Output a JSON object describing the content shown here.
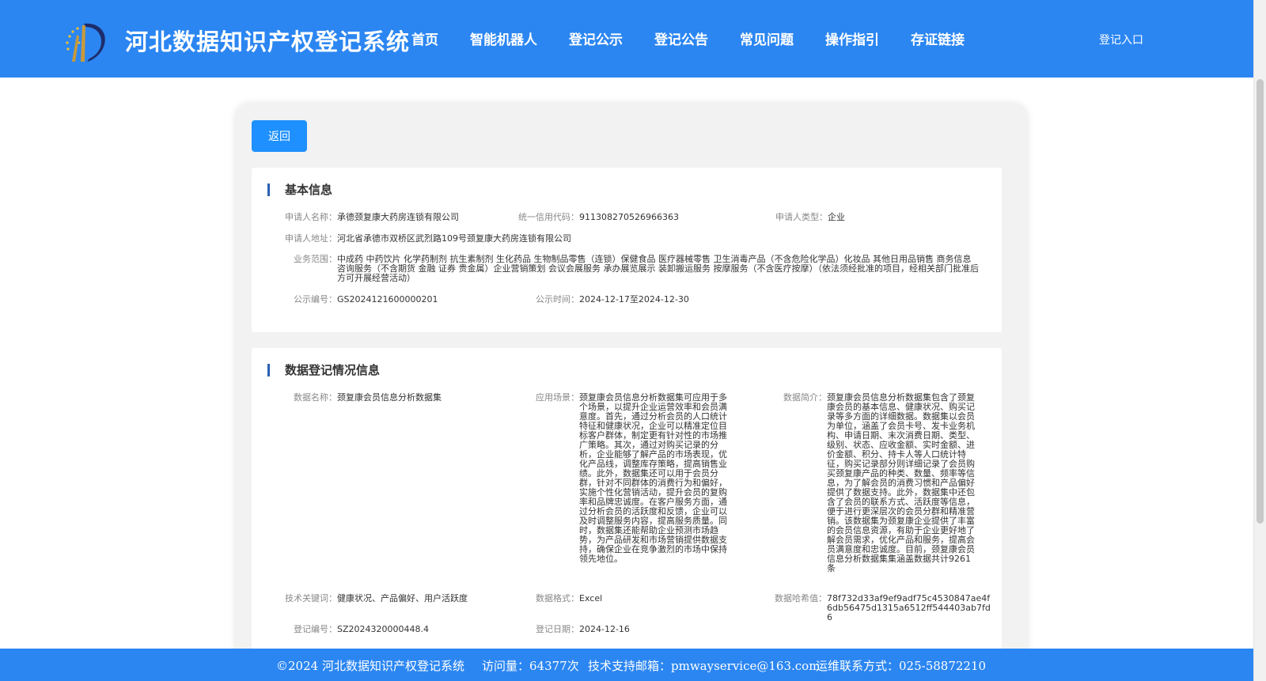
{
  "header": {
    "site_title": "河北数据知识产权登记系统",
    "nav": [
      "首页",
      "智能机器人",
      "登记公示",
      "登记公告",
      "常见问题",
      "操作指引",
      "存证链接"
    ],
    "login": "登记入口"
  },
  "back_button": "返回",
  "basic_info": {
    "title": "基本信息",
    "applicant_name": {
      "label": "申请人名称：",
      "value": "承德颈复康大药房连锁有限公司"
    },
    "credit_code": {
      "label": "统一信用代码：",
      "value": "911308270526966363"
    },
    "applicant_type": {
      "label": "申请人类型：",
      "value": "企业"
    },
    "address": {
      "label": "申请人地址：",
      "value": "河北省承德市双桥区武烈路109号颈复康大药房连锁有限公司"
    },
    "business_scope": {
      "label": "业务范围：",
      "value": "中成药 中药饮片 化学药制剂 抗生素制剂 生化药品 生物制品零售（连锁）保健食品 医疗器械零售 卫生消毒产品（不含危险化学品）化妆品 其他日用品销售 商务信息咨询服务（不含期货 金融 证券 贵金属）企业营销策划 会议会展服务 承办展览展示 装卸搬运服务 按摩服务（不含医疗按摩）（依法须经批准的项目，经相关部门批准后方可开展经营活动）"
    },
    "notice_no": {
      "label": "公示编号：",
      "value": "GS2024121600000201"
    },
    "notice_time": {
      "label": "公示时间：",
      "value": "2024-12-17至2024-12-30"
    }
  },
  "data_info": {
    "title": "数据登记情况信息",
    "data_name": {
      "label": "数据名称：",
      "value": "颈复康会员信息分析数据集"
    },
    "scenario": {
      "label": "应用场景：",
      "value": "颈复康会员信息分析数据集可应用于多个场景，以提升企业运营效率和会员满意度。首先，通过分析会员的人口统计特征和健康状况，企业可以精准定位目标客户群体，制定更有针对性的市场推广策略。其次，通过对购买记录的分析，企业能够了解产品的市场表现，优化产品线，调整库存策略，提高销售业绩。此外，数据集还可以用于会员分群，针对不同群体的消费行为和偏好，实施个性化营销活动，提升会员的复购率和品牌忠诚度。在客户服务方面，通过分析会员的活跃度和反馈，企业可以及时调整服务内容，提高服务质量。同时，数据集还能帮助企业预测市场趋势，为产品研发和市场营销提供数据支持，确保企业在竞争激烈的市场中保持领先地位。"
    },
    "summary": {
      "label": "数据简介：",
      "value": "颈复康会员信息分析数据集包含了颈复康会员的基本信息、健康状况、购买记录等多方面的详细数据。数据集以会员为单位，涵盖了会员卡号、发卡业务机构、申请日期、末次消费日期、类型、级别、状态、应收金额、实时金额、进价金额、积分、持卡人等人口统计特征，购买记录部分则详细记录了会员购买颈复康产品的种类、数量、频率等信息，为了解会员的消费习惯和产品偏好提供了数据支持。此外，数据集中还包含了会员的联系方式、活跃度等信息，便于进行更深层次的会员分群和精准营销。该数据集为颈复康企业提供了丰富的会员信息资源，有助于企业更好地了解会员需求，优化产品和服务，提高会员满意度和忠诚度。目前，颈复康会员信息分析数据集集涵盖数据共计9261条"
    },
    "keywords": {
      "label": "技术关键词：",
      "value": "健康状况、产品偏好、用户活跃度"
    },
    "format": {
      "label": "数据格式：",
      "value": "Excel"
    },
    "hash": {
      "label": "数据哈希值：",
      "value": "78f732d33af9ef9adf75c4530847ae4f6db56475d1315a6512ff544403ab7fd6"
    },
    "reg_no": {
      "label": "登记编号：",
      "value": "SZ2024320000448.4"
    },
    "reg_date": {
      "label": "登记日期：",
      "value": "2024-12-16"
    }
  },
  "footer": {
    "copyright": "©2024 河北数据知识产权登记系统",
    "visits": "访问量：64377次",
    "email": "技术支持邮箱：pmwayservice@163.com",
    "phone": "运维联系方式：025-58872210"
  },
  "colors": {
    "primary": "#2b86f2",
    "button": "#1e90ff",
    "section_bar": "#2b5fb5"
  }
}
